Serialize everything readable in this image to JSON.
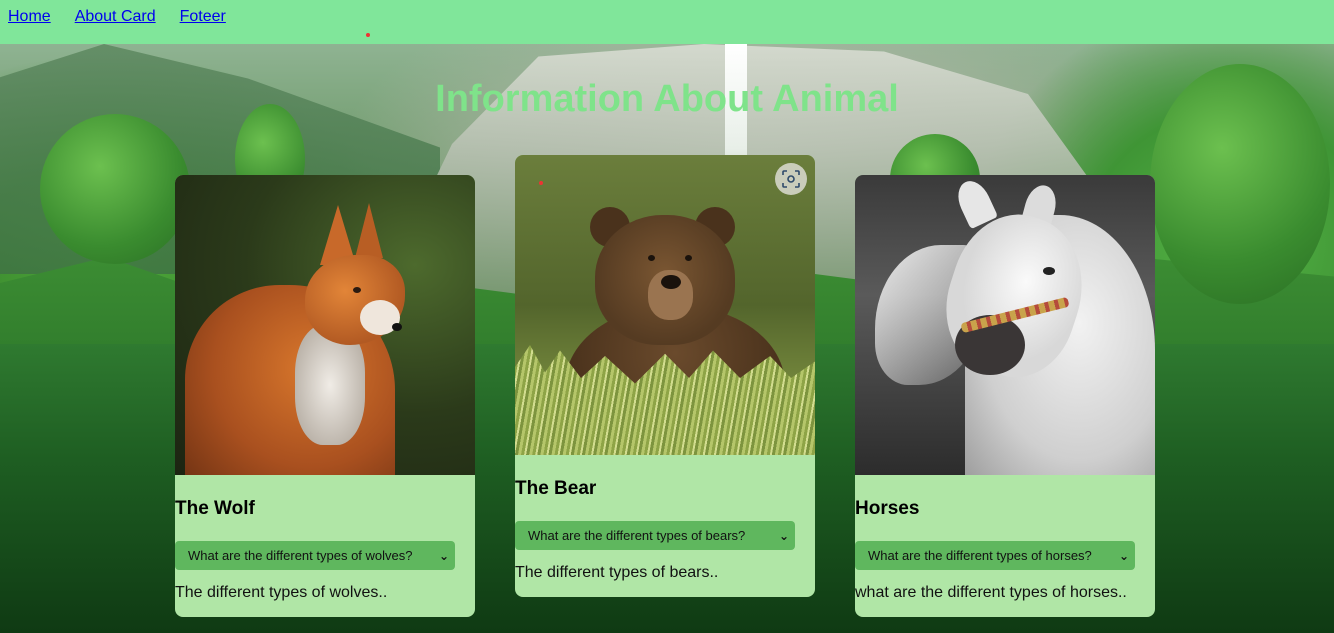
{
  "nav": {
    "links": [
      "Home",
      "About Card",
      "Foteer"
    ]
  },
  "page": {
    "heading": "Information About Animal"
  },
  "cards": [
    {
      "title": "The Wolf",
      "select_value": "What are the different types of wolves?",
      "description": "The different types of wolves.."
    },
    {
      "title": "The Bear",
      "select_value": "What are the different types of bears?",
      "description": "The different types of bears.."
    },
    {
      "title": "Horses",
      "select_value": "What are the different types of horses?",
      "description": "what are the different types of horses.."
    }
  ],
  "colors": {
    "nav_bg": "#80e69a",
    "heading": "#7fe38a",
    "card_bg": "#b0e6a6",
    "select_bg": "#5fb75e"
  },
  "icons": {
    "lens": "visual-search-icon",
    "select_arrow": "chevron-down-icon"
  }
}
